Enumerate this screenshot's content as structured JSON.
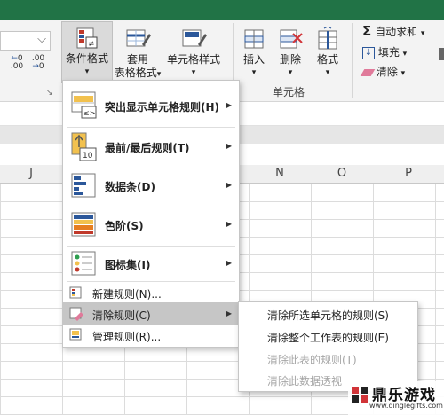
{
  "ribbon": {
    "decrease_decimal": ".00",
    "increase_decimal": ".00",
    "decimal_small": "0",
    "conditional_formatting": "条件格式",
    "format_as_table": [
      "套用",
      "表格格式"
    ],
    "cell_styles": "单元格样式",
    "insert": "插入",
    "delete": "删除",
    "format": "格式",
    "cells_group": "单元格",
    "autosum": "自动求和",
    "fill": "填充",
    "clear": "清除",
    "dropdown_arrow": "▾",
    "combo_chevron": "⌵",
    "launcher": "↘",
    "sigma": "Σ"
  },
  "columns": [
    "J",
    "N",
    "O",
    "P"
  ],
  "menu": {
    "items": [
      {
        "label": "突出显示单元格规则(H)",
        "has_submenu": true
      },
      {
        "label": "最前/最后规则(T)",
        "has_submenu": true
      },
      {
        "label": "数据条(D)",
        "has_submenu": true
      },
      {
        "label": "色阶(S)",
        "has_submenu": true
      },
      {
        "label": "图标集(I)",
        "has_submenu": true
      }
    ],
    "small_items": [
      {
        "label": "新建规则(N)..."
      },
      {
        "label": "清除规则(C)",
        "has_submenu": true,
        "highlighted": true
      },
      {
        "label": "管理规则(R)..."
      }
    ],
    "submenu_arrow": "▶",
    "highlight_label_text": "≤>",
    "top10_label_text": "10"
  },
  "submenu": {
    "items": [
      {
        "label": "清除所选单元格的规则(S)",
        "enabled": true
      },
      {
        "label": "清除整个工作表的规则(E)",
        "enabled": true
      },
      {
        "label": "清除此表的规则(T)",
        "enabled": false
      },
      {
        "label": "清除此数据透视",
        "enabled": false
      }
    ]
  },
  "watermark": {
    "title": "鼎乐游戏",
    "url": "www.dinglegifts.com"
  },
  "colors": {
    "title_bar": "#217346",
    "menu_highlight": "#c6c6c6",
    "disabled_text": "#a6a6a6"
  }
}
